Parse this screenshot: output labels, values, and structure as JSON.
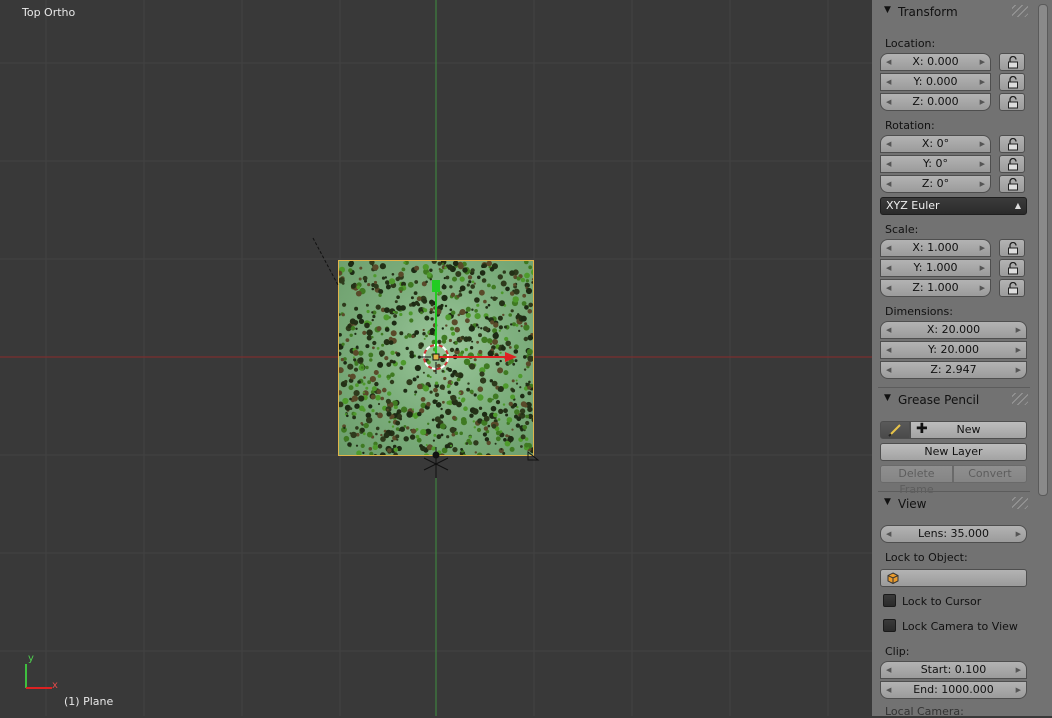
{
  "viewport": {
    "title": "Top Ortho",
    "object_label": "(1) Plane",
    "axis_x_label": "x",
    "axis_y_label": "y"
  },
  "panels": {
    "transform": {
      "title": "Transform",
      "location_label": "Location:",
      "location": [
        "X: 0.000",
        "Y: 0.000",
        "Z: 0.000"
      ],
      "rotation_label": "Rotation:",
      "rotation": [
        "X: 0°",
        "Y: 0°",
        "Z: 0°"
      ],
      "rotation_mode": "XYZ Euler",
      "scale_label": "Scale:",
      "scale": [
        "X: 1.000",
        "Y: 1.000",
        "Z: 1.000"
      ],
      "dimensions_label": "Dimensions:",
      "dimensions": [
        "X: 20.000",
        "Y: 20.000",
        "Z: 2.947"
      ]
    },
    "grease_pencil": {
      "title": "Grease Pencil",
      "new_label": "New",
      "new_layer_label": "New Layer",
      "delete_frame_label": "Delete Frame",
      "convert_label": "Convert"
    },
    "view": {
      "title": "View",
      "lens": "Lens: 35.000",
      "lock_object_label": "Lock to Object:",
      "lock_cursor_label": "Lock to Cursor",
      "lock_camera_label": "Lock Camera to View",
      "clip_label": "Clip:",
      "clip_start": "Start: 0.100",
      "clip_end": "End: 1000.000",
      "local_camera_label": "Local Camera:"
    }
  },
  "colors": {
    "viewport_bg": "#393939",
    "grid_line": "#444444",
    "x_axis": "#8a2a2a",
    "y_axis": "#3f8f3f",
    "selection_outline": "#e2b54a",
    "panel_bg": "#727272"
  }
}
